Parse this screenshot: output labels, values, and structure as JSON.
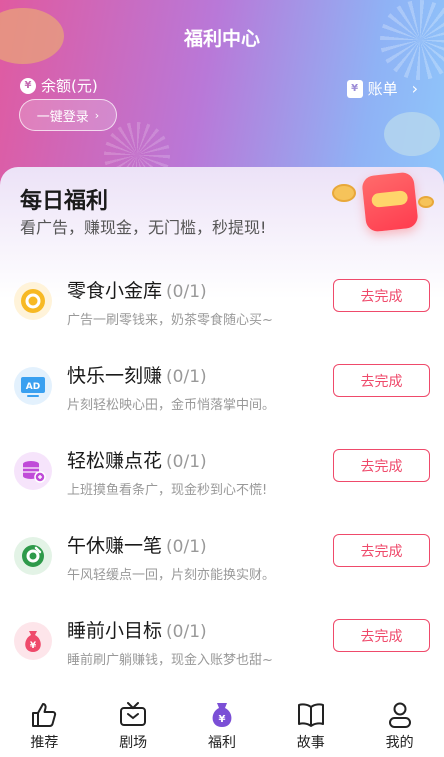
{
  "header": {
    "title": "福利中心",
    "balance_label": "余额(元)",
    "yen_symbol": "¥",
    "login_label": "一键登录",
    "bill_label": "账单"
  },
  "daily": {
    "title": "每日福利",
    "subtitle": "看广告，赚现金，无门槛，秒提现!"
  },
  "tasks": [
    {
      "name": "零食小金库",
      "count": "(0/1)",
      "desc": "广告一刷零钱来，奶茶零食随心买~",
      "button": "去完成",
      "icon": "coin-icon",
      "color": "#f7b924"
    },
    {
      "name": "快乐一刻赚",
      "count": "(0/1)",
      "desc": "片刻轻松映心田，金币悄落掌中间。",
      "button": "去完成",
      "icon": "ad-icon",
      "color": "#3aa0f0"
    },
    {
      "name": "轻松赚点花",
      "count": "(0/1)",
      "desc": "上班摸鱼看条广，现金秒到心不慌!",
      "button": "去完成",
      "icon": "coin-stack-icon",
      "color": "#c04bd8"
    },
    {
      "name": "午休赚一笔",
      "count": "(0/1)",
      "desc": "午风轻缓点一回，片刻亦能换实财。",
      "button": "去完成",
      "icon": "ring-icon",
      "color": "#2e9a4a"
    },
    {
      "name": "睡前小目标",
      "count": "(0/1)",
      "desc": "睡前刷广躺赚钱，现金入账梦也甜~",
      "button": "去完成",
      "icon": "money-bag-icon",
      "color": "#ef4a6b"
    }
  ],
  "nav": [
    {
      "label": "推荐",
      "icon": "thumbs-up-icon",
      "active": false
    },
    {
      "label": "剧场",
      "icon": "tv-icon",
      "active": false
    },
    {
      "label": "福利",
      "icon": "money-bag-icon",
      "active": true
    },
    {
      "label": "故事",
      "icon": "book-icon",
      "active": false
    },
    {
      "label": "我的",
      "icon": "person-icon",
      "active": false
    }
  ],
  "colors": {
    "accent": "#ef4a6b",
    "header_start": "#e05aa0",
    "header_end": "#8fc8fb",
    "active_tab": "#7b4fd6"
  }
}
